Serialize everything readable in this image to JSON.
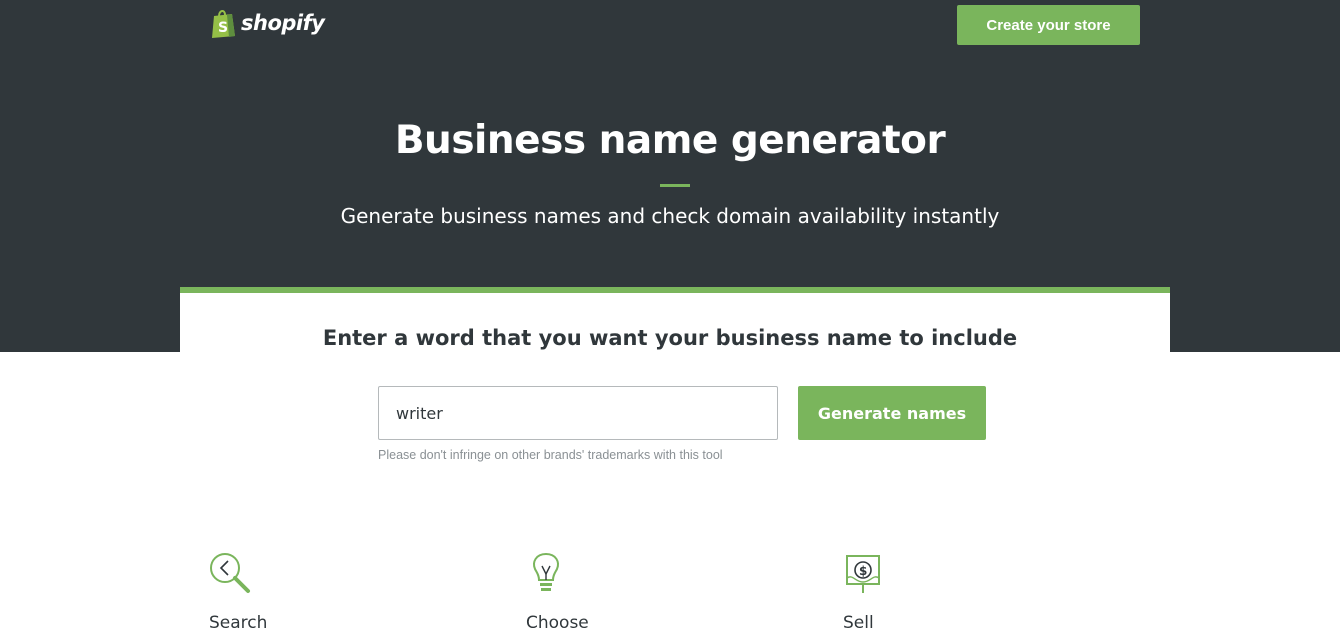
{
  "header": {
    "logo_text": "shopify",
    "logo_icon": "shopping-bag-icon",
    "cta_label": "Create your store"
  },
  "hero": {
    "title": "Business name generator",
    "subtitle": "Generate business names and check domain availability instantly"
  },
  "form": {
    "prompt": "Enter a word that you want your business name to include",
    "input_value": "writer",
    "submit_label": "Generate names",
    "disclaimer": "Please don't infringe on other brands' trademarks with this tool"
  },
  "features": [
    {
      "label": "Search",
      "icon": "magnifier-icon"
    },
    {
      "label": "Choose",
      "icon": "lightbulb-icon"
    },
    {
      "label": "Sell",
      "icon": "dollar-sign-icon"
    }
  ],
  "colors": {
    "hero_bg": "#30373b",
    "accent_green": "#7ab55c",
    "text_dark": "#30373b",
    "text_muted": "#8a9094"
  }
}
